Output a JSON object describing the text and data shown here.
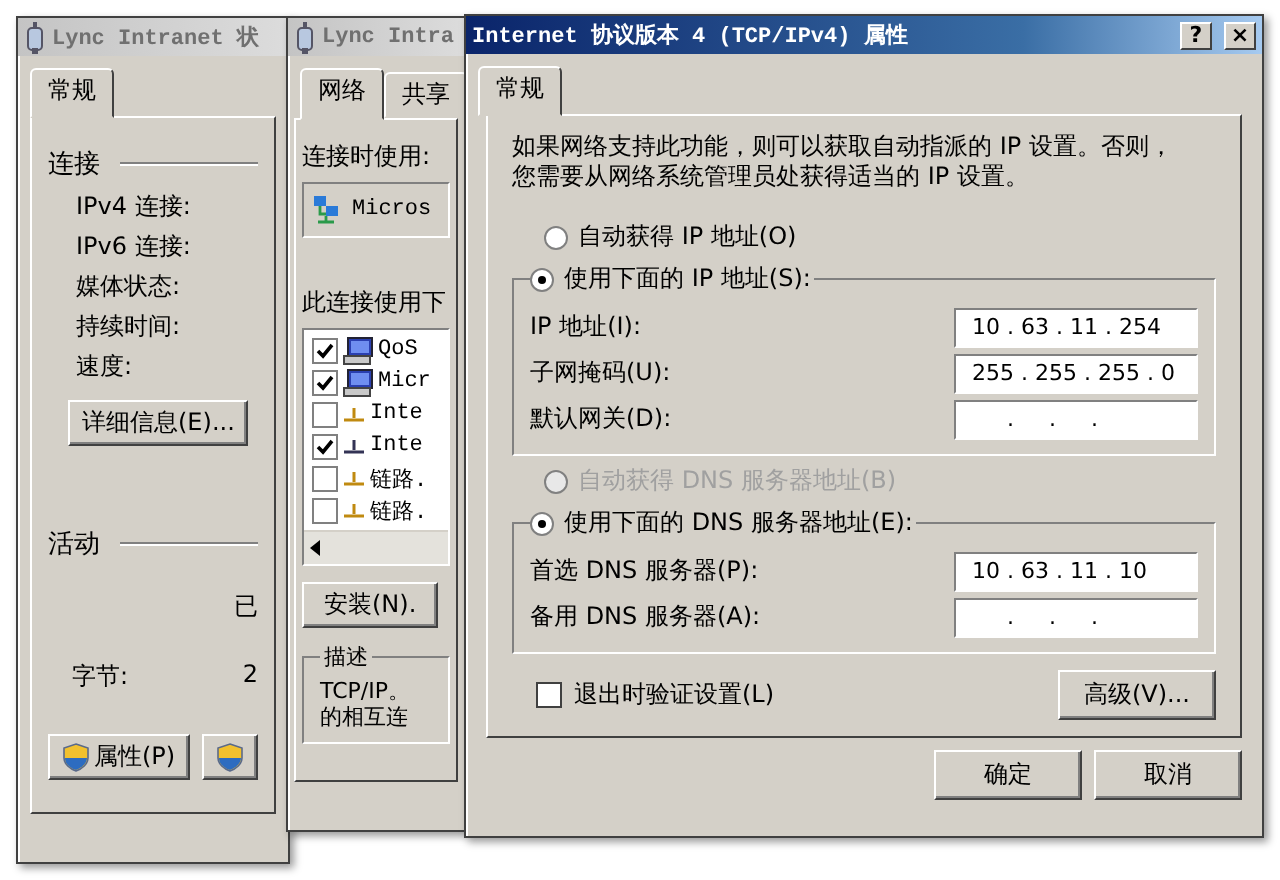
{
  "windows": [
    {
      "kind": "status",
      "title": "Lync Intranet 状",
      "active": false,
      "tabs": [
        {
          "label": "常规",
          "selected": true
        }
      ],
      "connection": {
        "heading": "连接",
        "labels": [
          "IPv4 连接:",
          "IPv6 连接:",
          "媒体状态:",
          "持续时间:",
          "速度:"
        ],
        "details_button": "详细信息(E)..."
      },
      "activity": {
        "heading": "活动",
        "sent": "已",
        "bytes_label": "字节:",
        "bytes_sent": "2"
      },
      "buttons": [
        {
          "label": "属性(P)",
          "shield": true
        },
        {
          "shield": true
        }
      ]
    },
    {
      "kind": "network",
      "title": "Lync Intra",
      "active": false,
      "tabs": [
        {
          "label": "网络",
          "selected": true
        },
        {
          "label": "共享",
          "selected": false
        }
      ],
      "connect_using_label": "连接时使用:",
      "adapter": "Micros",
      "items_label": "此连接使用下",
      "items": [
        {
          "label": "QoS",
          "checked": true,
          "kind": "computer"
        },
        {
          "label": "Micr",
          "checked": true,
          "kind": "computer"
        },
        {
          "label": "Inte",
          "checked": false,
          "kind": "network"
        },
        {
          "label": "Inte",
          "checked": true,
          "kind": "network"
        },
        {
          "label": "链路.",
          "checked": false,
          "kind": "network"
        },
        {
          "label": "链路.",
          "checked": false,
          "kind": "network"
        }
      ],
      "install_button": "安装(N).",
      "description": {
        "legend": "描述",
        "lines": [
          "TCP/IP。",
          "的相互连"
        ]
      }
    },
    {
      "kind": "ipv4",
      "title": "Internet 协议版本 4 (TCP/IPv4) 属性",
      "active": true,
      "title_buttons": [
        {
          "label": "?",
          "kind": "help"
        },
        {
          "label": "×",
          "kind": "close"
        }
      ],
      "tabs": [
        {
          "label": "常规",
          "selected": true
        }
      ],
      "intro": "如果网络支持此功能，则可以获取自动指派的 IP 设置。否则，您需要从网络系统管理员处获得适当的 IP 设置。",
      "ip_mode": [
        {
          "label": "自动获得 IP 地址(O)",
          "selected": false,
          "disabled": false
        },
        {
          "label": "使用下面的 IP 地址(S):",
          "selected": true,
          "disabled": false
        }
      ],
      "ip_fields": [
        {
          "label": "IP 地址(I):",
          "value": "10 . 63 . 11 . 254"
        },
        {
          "label": "子网掩码(U):",
          "value": "255 . 255 . 255 . 0"
        },
        {
          "label": "默认网关(D):",
          "value": "     .     .     ."
        }
      ],
      "dns_mode": [
        {
          "label": "自动获得 DNS 服务器地址(B)",
          "selected": false,
          "disabled": true
        },
        {
          "label": "使用下面的 DNS 服务器地址(E):",
          "selected": true,
          "disabled": false
        }
      ],
      "dns_fields": [
        {
          "label": "首选 DNS 服务器(P):",
          "value": "10 . 63 . 11 . 10"
        },
        {
          "label": "备用 DNS 服务器(A):",
          "value": "     .     .     ."
        }
      ],
      "validate": {
        "label": "退出时验证设置(L)",
        "checked": false
      },
      "advanced_button": "高级(V)...",
      "ok_button": "确定",
      "cancel_button": "取消"
    }
  ]
}
